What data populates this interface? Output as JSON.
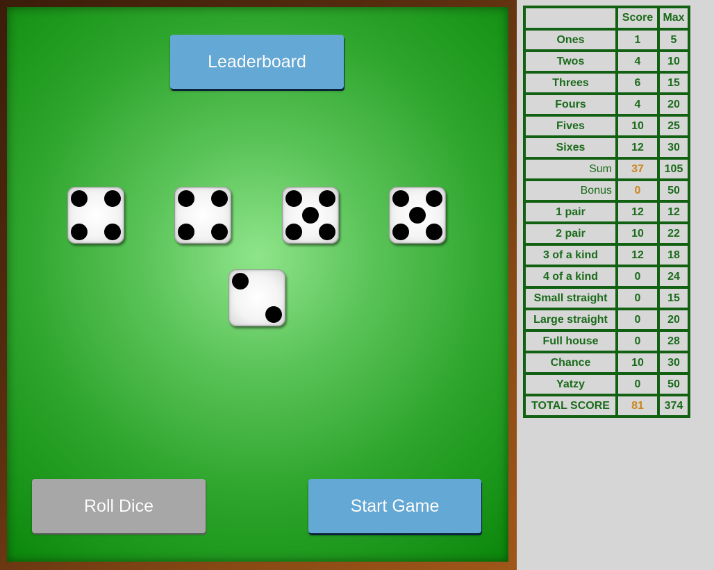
{
  "buttons": {
    "leaderboard": "Leaderboard",
    "roll": "Roll Dice",
    "start": "Start Game"
  },
  "dice": [
    4,
    4,
    5,
    5,
    2
  ],
  "scorecard": {
    "headers": [
      "",
      "Score",
      "Max"
    ],
    "rows": [
      {
        "label": "Ones",
        "score": "1",
        "max": "5"
      },
      {
        "label": "Twos",
        "score": "4",
        "max": "10"
      },
      {
        "label": "Threes",
        "score": "6",
        "max": "15"
      },
      {
        "label": "Fours",
        "score": "4",
        "max": "20"
      },
      {
        "label": "Fives",
        "score": "10",
        "max": "25"
      },
      {
        "label": "Sixes",
        "score": "12",
        "max": "30"
      },
      {
        "label": "Sum",
        "score": "37",
        "max": "105"
      },
      {
        "label": "Bonus",
        "score": "0",
        "max": "50"
      },
      {
        "label": "1 pair",
        "score": "12",
        "max": "12"
      },
      {
        "label": "2 pair",
        "score": "10",
        "max": "22"
      },
      {
        "label": "3 of a kind",
        "score": "12",
        "max": "18"
      },
      {
        "label": "4 of a kind",
        "score": "0",
        "max": "24"
      },
      {
        "label": "Small straight",
        "score": "0",
        "max": "15"
      },
      {
        "label": "Large straight",
        "score": "0",
        "max": "20"
      },
      {
        "label": "Full house",
        "score": "0",
        "max": "28"
      },
      {
        "label": "Chance",
        "score": "10",
        "max": "30"
      },
      {
        "label": "Yatzy",
        "score": "0",
        "max": "50"
      },
      {
        "label": "TOTAL SCORE",
        "score": "81",
        "max": "374"
      }
    ]
  },
  "colors": {
    "felt": "#2ea52c",
    "button_blue": "#64a9d6",
    "button_gray": "#a7a7a7",
    "table_text": "#1a6b1a",
    "highlight": "#c9861c"
  }
}
